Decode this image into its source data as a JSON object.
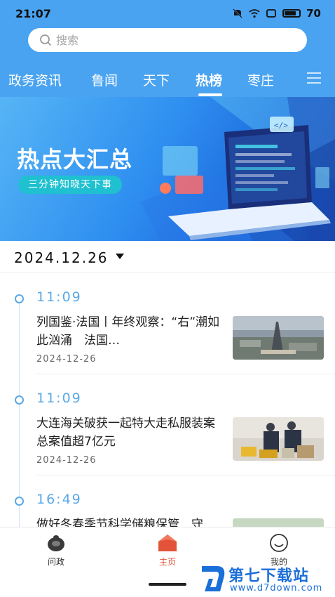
{
  "status": {
    "time": "21:07",
    "battery": "70"
  },
  "search": {
    "placeholder": "搜索"
  },
  "tabs": [
    {
      "label": "政务资讯"
    },
    {
      "label": "鲁闻"
    },
    {
      "label": "天下"
    },
    {
      "label": "热榜",
      "active": true
    },
    {
      "label": "枣庄"
    }
  ],
  "banner": {
    "title": "热点大汇总",
    "subtitle": "三分钟知晓天下事"
  },
  "date_selector": {
    "value": "2024.12.26"
  },
  "timeline": [
    {
      "time": "11:09",
      "title": "列国鉴·法国丨年终观察：“右”潮如此汹涌　法国…",
      "date": "2024-12-26"
    },
    {
      "time": "11:09",
      "title": "大连海关破获一起特大走私服装案　总案值超7亿元",
      "date": "2024-12-26"
    },
    {
      "time": "16:49",
      "title": "做好冬春季节科学储粮保管　守",
      "date": ""
    }
  ],
  "bottom_nav": [
    {
      "label": "问政",
      "icon": "shell-icon"
    },
    {
      "label": "主页",
      "icon": "home-icon",
      "active": true
    },
    {
      "label": "我的",
      "icon": "smile-icon"
    }
  ],
  "watermark": {
    "title": "第七下载站",
    "url": "www.d7down.com"
  },
  "colors": {
    "header": "#4aa3f0",
    "accent": "#5aa9e6",
    "active_nav": "#e2533a"
  }
}
